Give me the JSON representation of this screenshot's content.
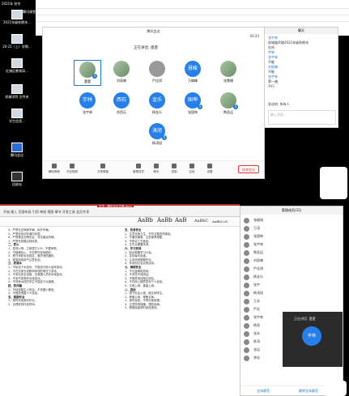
{
  "desktop": {
    "taskbar_label": "2021年 秋冬",
    "taskbar_label2": "腾讯课堂",
    "icons": [
      {
        "label": "2021年级秋期末..."
      },
      {
        "label": "20-21（上）学期..."
      },
      {
        "label": "红旗区教育局..."
      },
      {
        "label": "机械学院 文件夹"
      },
      {
        "label": "学生信息..."
      },
      {
        "label": "腾讯会议"
      },
      {
        "label": "回收站"
      }
    ]
  },
  "meeting": {
    "window_title": "腾讯会议",
    "time": "43:33",
    "subtitle": "正在讲话: 蘆蘆",
    "participants": [
      {
        "name": "蘆蘆",
        "initial": "",
        "style": "photo",
        "badge": "5",
        "selected": true
      },
      {
        "name": "刘丽喃",
        "initial": "",
        "style": "photo",
        "badge": ""
      },
      {
        "name": "严佳琪",
        "initial": "",
        "style": "photo",
        "badge": ""
      },
      {
        "name": "万琳峰",
        "initial": "慧峻",
        "style": "blue",
        "badge": ""
      },
      {
        "name": "张慧珊",
        "initial": "",
        "style": "photo",
        "badge": ""
      },
      {
        "name": "张宇林",
        "initial": "宇林",
        "style": "blue",
        "badge": ""
      },
      {
        "name": "徐西石",
        "initial": "西石",
        "style": "blue",
        "badge": ""
      },
      {
        "name": "杨金乐",
        "initial": "金乐",
        "style": "blue",
        "badge": ""
      },
      {
        "name": "张国坤",
        "initial": "国坤",
        "style": "blue",
        "badge": "5"
      },
      {
        "name": "陶圣运",
        "initial": "",
        "style": "photo",
        "badge": "5"
      },
      {
        "name": "杨涛旭",
        "initial": "涛旭",
        "style": "blue",
        "badge": "5"
      }
    ],
    "toolbar": [
      "解除静音",
      "开启视频",
      "共享屏幕",
      "管理成员",
      "聊天",
      "录制",
      "应用",
      "设置"
    ],
    "end_button": "结束会议"
  },
  "panel": {
    "title": "聊天",
    "lines": [
      "张宇林",
      "虎城路声路2021年级秋期末",
      "在的",
      "宇林",
      "张宇林",
      "不能",
      "刘丽喃",
      "不能",
      "张宇林",
      "第一遍",
      "不行"
    ],
    "send_label": "发送给: 所有人",
    "input_placeholder": "输入消息..."
  },
  "word": {
    "title_bar": "文字 - 腾讯会议文稿.docx",
    "ribbon": "开始 插入 页面布局 引用 审阅 视图 章节 开发工具 会员专享",
    "styles": [
      "AaBb",
      "AaBb",
      "AaB",
      "AaBbC",
      "AaBbCcD"
    ],
    "left_col": [
      "4、严禁无证驾驶车辆，私开车辆。",
      "5、严禁在机动车道内玩耍。",
      "6、严禁乘坐无牌无证、非法营运车辆。",
      "7、严禁在铁路沿线玩耍。",
      "二、防火",
      "1、发现火情，立即拨打119，不要惊慌。",
      "2、不随便玩火，不在野外焚烧秸秆。",
      "3、遵守消防安全规定，爱护消防器材。",
      "4、家庭用电用气注意安全。",
      "三、防溺水",
      "1、不私自下水游泳，不擅自与他人结伴游泳。",
      "2、不在无家长或教师带领的情况下游泳。",
      "3、不到无安全设施、无救援人员的水域游泳。",
      "4、不到不熟悉的水域游泳。",
      "5、不熟悉水性的学生不擅自下水施救。",
      "四、防诈骗",
      "1、不轻信陌生人的话，不贪图小便宜。",
      "2、不随意透露个人信息。",
      "五、假期作业",
      "1、按时完成各科作业。",
      "2、合理安排作息时间。"
    ],
    "right_col": [
      "五、饮食安全",
      "1、注意饮食卫生，不吃过期变质食品。",
      "2、不暴饮暴食，注意营养搭配。",
      "3、不购买三无食品。",
      "4、生吃瓜果要洗净。",
      "六、学习安排",
      "1、制定假期学习计划。",
      "2、坚持每天阅读。",
      "3、认真完成假期作业。",
      "4、多参加社会实践活动。",
      "七、网络安全",
      "1、不沉迷网络游戏。",
      "2、不浏览不良网站。",
      "3、不随意添加陌生网友。",
      "4、不在网上随意发布个人信息。",
      "5、文明上网，健康上网。",
      "八、其他",
      "1、遵守社会公德，做文明学生。",
      "2、孝敬父母，尊敬长辈。",
      "3、按时返校，不得无故缺课。",
      "4、注意防寒保暖，预防疾病。",
      "5、假期结束按时返校报到。"
    ]
  },
  "side": {
    "title": "管理成员(31)",
    "members": [
      "张峻瑞",
      "万涛",
      "张国坤",
      "张宇林",
      "陶圣运",
      "刘丽喃",
      "严佳琪",
      "杨金乐",
      "张宇",
      "杨涛旭",
      "王永",
      "严佳",
      "张宇林",
      "杨思",
      "张永",
      "陈涛",
      "张运",
      "李佳"
    ],
    "video_caption": "正在讲话: 蘆蘆",
    "video_initial": "宇林",
    "footer_left": "全体静音",
    "footer_right": "解除全体静音"
  }
}
